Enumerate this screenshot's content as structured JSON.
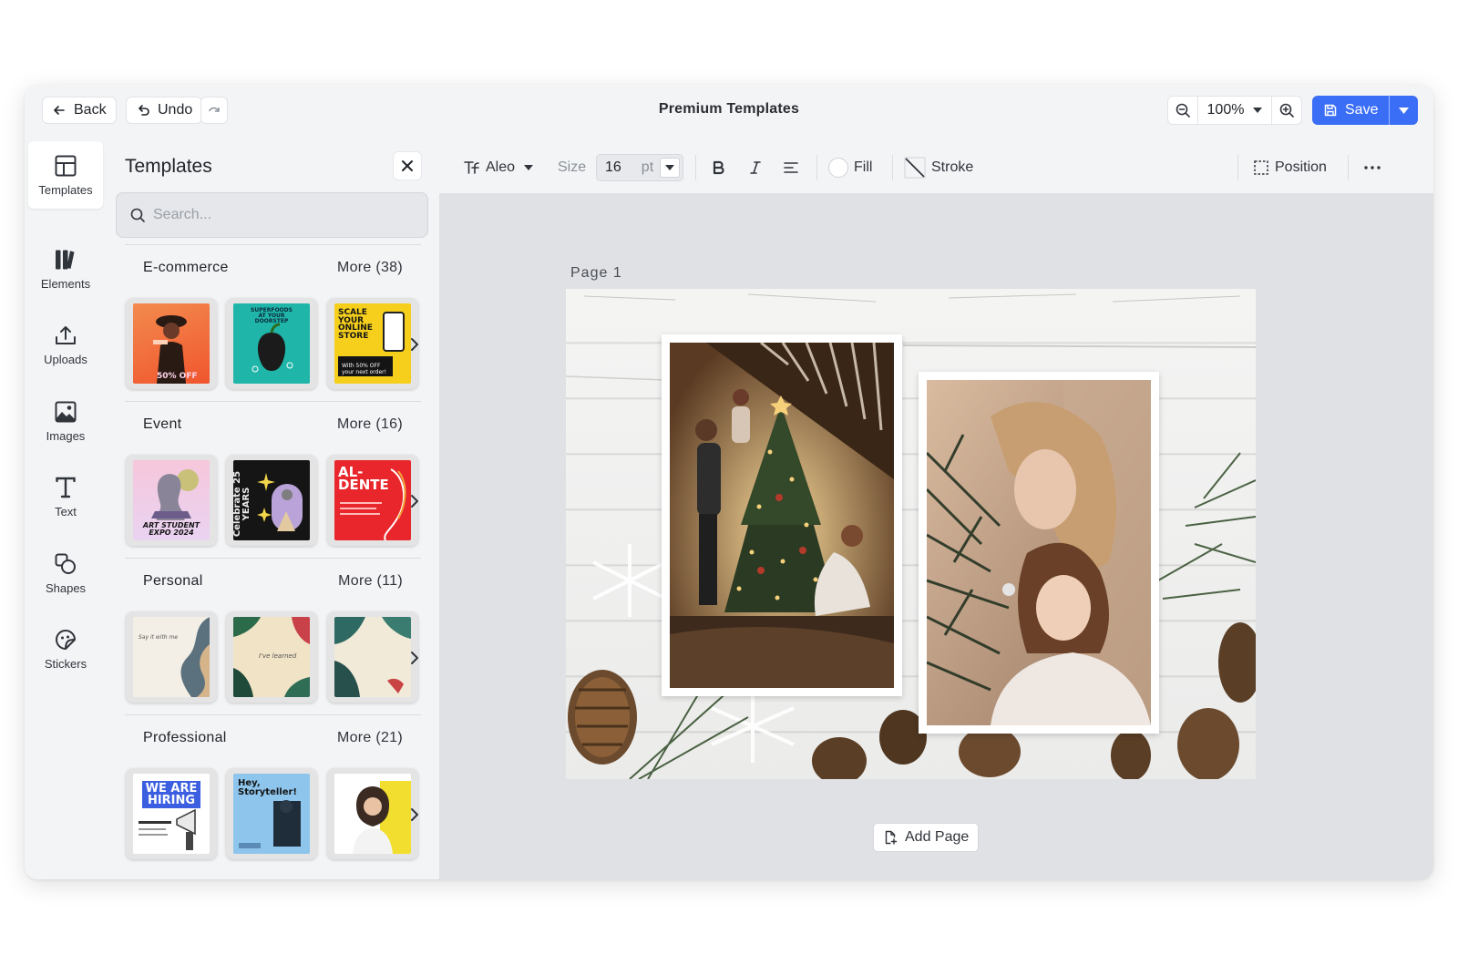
{
  "window": {
    "title": "Premium Templates"
  },
  "topbar": {
    "back_label": "Back",
    "undo_label": "Undo",
    "zoom_value": "100%",
    "save_label": "Save"
  },
  "rail": {
    "items": [
      {
        "label": "Templates",
        "icon": "layout-icon"
      },
      {
        "label": "Elements",
        "icon": "elements-icon"
      },
      {
        "label": "Uploads",
        "icon": "upload-icon"
      },
      {
        "label": "Images",
        "icon": "image-icon"
      },
      {
        "label": "Text",
        "icon": "text-icon"
      },
      {
        "label": "Shapes",
        "icon": "shapes-icon"
      },
      {
        "label": "Stickers",
        "icon": "sticker-icon"
      }
    ]
  },
  "panel": {
    "title": "Templates",
    "search_placeholder": "Search...",
    "categories": [
      {
        "name": "E-commerce",
        "more": "More (38)",
        "thumbs": [
          {
            "text": "50% OFF",
            "bg": "#e9e9ea",
            "accent": "#f0552d"
          },
          {
            "text": "SUPERFOODS AT YOUR DOORSTEP",
            "bg": "#e9e9ea",
            "accent": "#1fb5a8"
          },
          {
            "text": "SCALE YOUR ONLINE STORE",
            "bg": "#e9e9ea",
            "accent": "#f6cf1c"
          }
        ]
      },
      {
        "name": "Event",
        "more": "More (16)",
        "thumbs": [
          {
            "text": "ART STUDENT EXPO 2024",
            "bg": "#e9e9ea",
            "accent": "#f1c2d8"
          },
          {
            "text": "Celebrate 25 YEARS",
            "bg": "#e9e9ea",
            "accent": "#151515"
          },
          {
            "text": "AL-DENTE",
            "bg": "#e9e9ea",
            "accent": "#e8262b"
          }
        ]
      },
      {
        "name": "Personal",
        "more": "More (11)",
        "thumbs": [
          {
            "text": "Say it with me",
            "bg": "#e9e9ea",
            "accent": "#f3efe6"
          },
          {
            "text": "I've learned",
            "bg": "#e9e9ea",
            "accent": "#f1e3c5"
          },
          {
            "text": "",
            "bg": "#e9e9ea",
            "accent": "#f2ead8"
          }
        ]
      },
      {
        "name": "Professional",
        "more": "More (21)",
        "thumbs": [
          {
            "text": "WE ARE HIRING",
            "bg": "#e9e9ea",
            "accent": "#ffffff"
          },
          {
            "text": "Hey, Storyteller!",
            "bg": "#e9e9ea",
            "accent": "#8ec5ec"
          },
          {
            "text": "",
            "bg": "#e9e9ea",
            "accent": "#ffffff"
          }
        ]
      }
    ]
  },
  "toolbar": {
    "font_name": "Aleo",
    "size_label": "Size",
    "size_value": "16",
    "size_unit": "pt",
    "fill_label": "Fill",
    "stroke_label": "Stroke",
    "position_label": "Position"
  },
  "canvas": {
    "page_label": "Page  1",
    "add_page_label": "Add Page"
  },
  "colors": {
    "accent": "#3b6ef6",
    "window_bg": "#f3f4f6",
    "canvas_bg": "#dfe1e4"
  }
}
